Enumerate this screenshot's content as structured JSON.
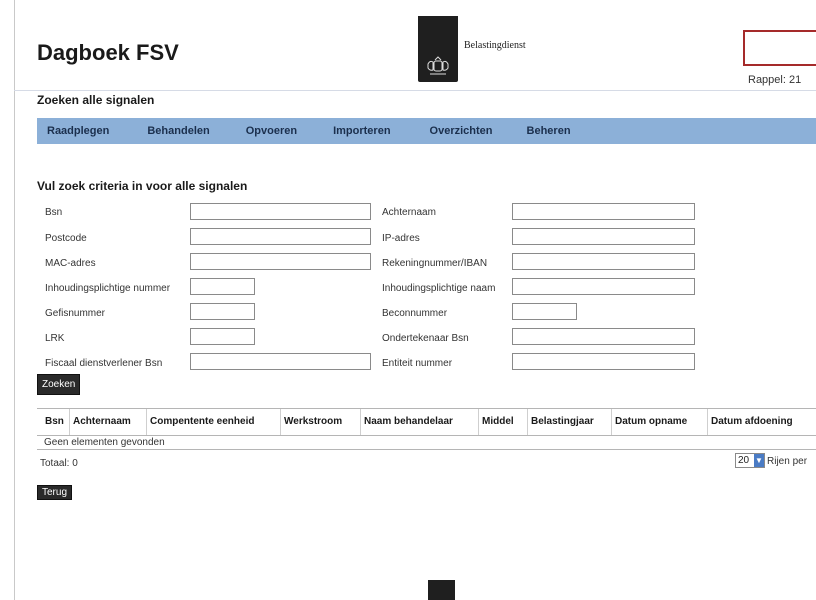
{
  "header": {
    "app_title": "Dagboek FSV",
    "logo_text": "Belastingdienst",
    "rappel": "Rappel: 21"
  },
  "page_heading": "Zoeken alle signalen",
  "nav": {
    "items": [
      {
        "label": "Raadplegen"
      },
      {
        "label": "Behandelen"
      },
      {
        "label": "Opvoeren"
      },
      {
        "label": "Importeren"
      },
      {
        "label": "Overzichten"
      },
      {
        "label": "Beheren"
      }
    ]
  },
  "search": {
    "title": "Vul zoek criteria in voor alle signalen",
    "left_fields": [
      {
        "label": "Bsn",
        "value": ""
      },
      {
        "label": "Postcode",
        "value": ""
      },
      {
        "label": "MAC-adres",
        "value": ""
      },
      {
        "label": "Inhoudingsplichtige nummer",
        "value": ""
      },
      {
        "label": "Gefisnummer",
        "value": ""
      },
      {
        "label": "LRK",
        "value": ""
      },
      {
        "label": "Fiscaal dienstverlener Bsn",
        "value": ""
      }
    ],
    "right_fields": [
      {
        "label": "Achternaam",
        "value": ""
      },
      {
        "label": "IP-adres",
        "value": ""
      },
      {
        "label": "Rekeningnummer/IBAN",
        "value": ""
      },
      {
        "label": "Inhoudingsplichtige naam",
        "value": ""
      },
      {
        "label": "Beconnummer",
        "value": ""
      },
      {
        "label": "Ondertekenaar Bsn",
        "value": ""
      },
      {
        "label": "Entiteit nummer",
        "value": ""
      }
    ],
    "submit_label": "Zoeken"
  },
  "results": {
    "columns": [
      "Bsn",
      "Achternaam",
      "Compentente eenheid",
      "Werkstroom",
      "Naam behandelaar",
      "Middel",
      "Belastingjaar",
      "Datum opname",
      "Datum afdoening"
    ],
    "empty_message": "Geen elementen gevonden",
    "total_label": "Totaal: 0",
    "page_size": "20",
    "page_size_label": "Rijen per"
  },
  "back_label": "Terug",
  "colors": {
    "nav_bg": "#8cb0d8",
    "nav_text": "#1b2f4d",
    "alert_border": "#a52a2a",
    "button_bg": "#2a2a2a"
  }
}
